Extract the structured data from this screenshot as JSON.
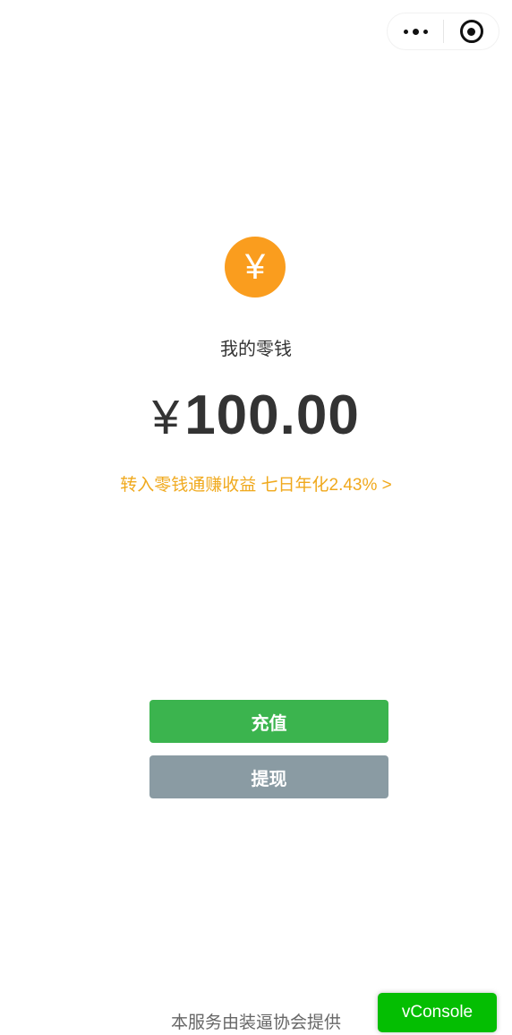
{
  "capsule": {
    "more_icon": "more-dots-icon",
    "close_icon": "target-circle-icon"
  },
  "wallet": {
    "coin_symbol": "¥",
    "label": "我的零钱",
    "currency_symbol": "¥",
    "amount": "100.00",
    "promo_text": "转入零钱通赚收益 七日年化2.43% >"
  },
  "actions": {
    "recharge_label": "充值",
    "withdraw_label": "提现"
  },
  "footer": {
    "text": "本服务由装逼协会提供"
  },
  "vconsole": {
    "label": "vConsole"
  },
  "colors": {
    "coin": "#fa9d1e",
    "promo": "#f0a91d",
    "recharge": "#3bb44e",
    "withdraw": "#8a9ba3",
    "vconsole": "#04be02"
  }
}
